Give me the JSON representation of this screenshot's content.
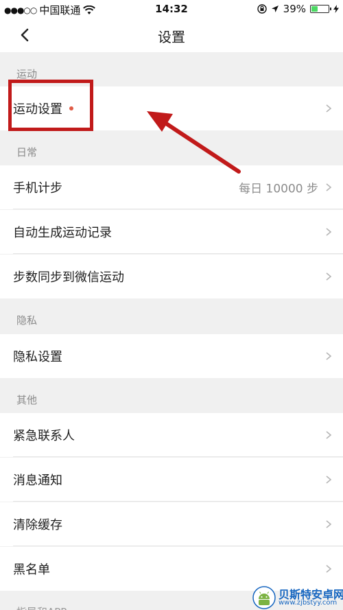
{
  "status_bar": {
    "signal": "●●●○○",
    "carrier": "中国联通",
    "time": "14:32",
    "battery_percent": "39%",
    "battery_level": 0.39
  },
  "nav": {
    "title": "设置"
  },
  "sections": [
    {
      "header": "运动",
      "items": [
        {
          "label": "运动设置",
          "has_dot": true
        }
      ]
    },
    {
      "header": "日常",
      "items": [
        {
          "label": "手机计步",
          "value": "每日 10000 步"
        },
        {
          "label": "自动生成运动记录"
        },
        {
          "label": "步数同步到微信运动"
        }
      ]
    },
    {
      "header": "隐私",
      "items": [
        {
          "label": "隐私设置"
        }
      ]
    },
    {
      "header": "其他",
      "items": [
        {
          "label": "紧急联系人"
        },
        {
          "label": "消息通知"
        },
        {
          "label": "清除缓存"
        },
        {
          "label": "黑名单"
        }
      ]
    },
    {
      "header": "指导和APP"
    }
  ],
  "watermark": {
    "title": "贝斯特安卓网",
    "url": "www.zjbstyy.com"
  },
  "colors": {
    "accent_dot": "#e05a45",
    "annotation_red": "#c11a1a",
    "watermark_blue": "#1565c0"
  }
}
